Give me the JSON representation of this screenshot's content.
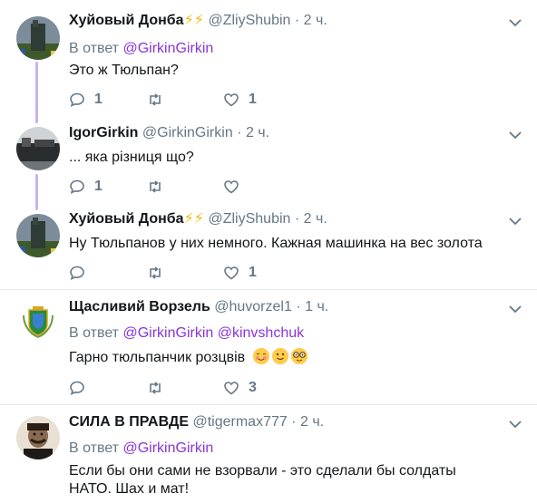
{
  "tweets": [
    {
      "name": "Хуйовый Донба",
      "bolts": "⚡⚡",
      "handle": "@ZliyShubin",
      "time": "2 ч.",
      "reply_label": "В ответ",
      "mentions": "@GirkinGirkin",
      "text": "Это ж Тюльпан?",
      "replies": "1",
      "retweets": "",
      "likes": "1"
    },
    {
      "name": "IgorGirkin",
      "handle": "@GirkinGirkin",
      "time": "2 ч.",
      "text": "... яка різниця що?",
      "replies": "1",
      "retweets": "",
      "likes": ""
    },
    {
      "name": "Хуйовый Донба",
      "bolts": "⚡⚡",
      "handle": "@ZliyShubin",
      "time": "2 ч.",
      "text": "Ну Тюльпанов у них немного. Кажная машинка на вес золота",
      "replies": "",
      "retweets": "",
      "likes": "1"
    },
    {
      "name": "Щасливий Ворзель",
      "handle": "@huvorzel1",
      "time": "1 ч.",
      "reply_label": "В ответ",
      "mention1": "@GirkinGirkin",
      "mention2": "@kinvshchuk",
      "text": "Гарно тюльпанчик розцвів",
      "replies": "",
      "retweets": "",
      "likes": "3"
    },
    {
      "name": "СИЛА В ПРАВДЕ",
      "handle": "@tigermax777",
      "time": "2 ч.",
      "reply_label": "В ответ",
      "mentions": "@GirkinGirkin",
      "text_line1": "Если бы они сами не взорвали - это сделали бы солдаты",
      "text_line2": "НАТО.  Шах и мат!"
    }
  ],
  "separator": "·",
  "colors": {
    "mention": "#8a34d6",
    "thread_line": "#c7b3f0",
    "meta": "#657786"
  },
  "icons": [
    "reply-icon",
    "retweet-icon",
    "like-icon",
    "chevron-down-icon"
  ]
}
